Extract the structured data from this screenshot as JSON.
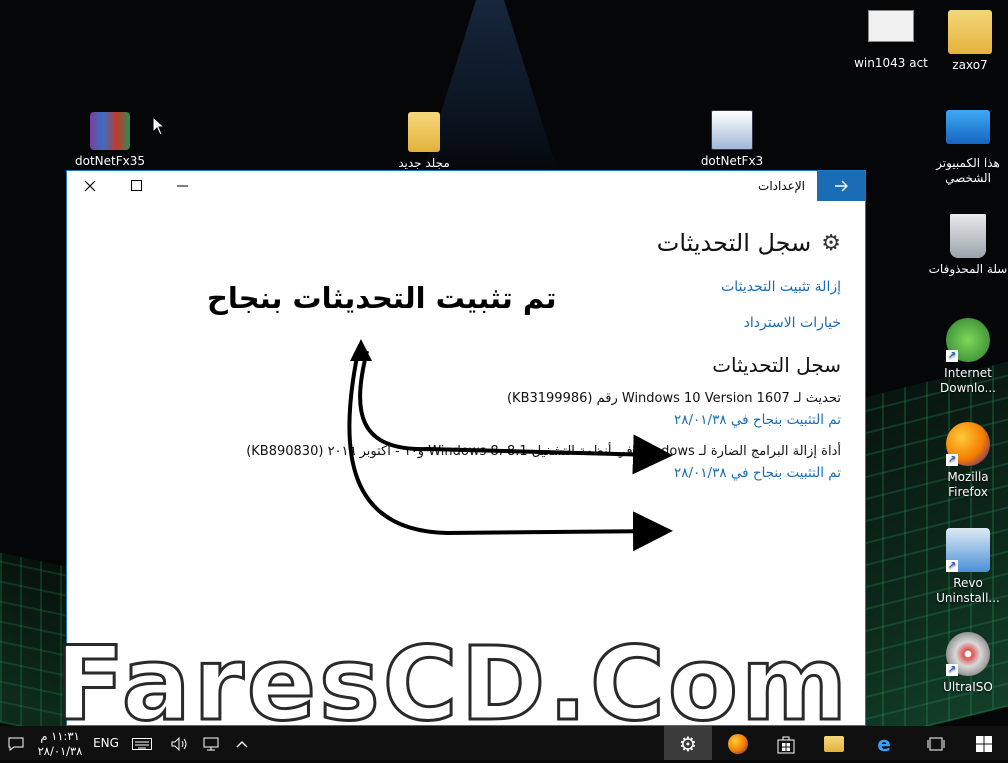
{
  "desktop": {
    "icons": [
      {
        "label": "zaxo7"
      },
      {
        "label": "win1043 act"
      },
      {
        "label": "هذا الكمبيوتر الشخصي"
      },
      {
        "label": "سلة المحذوفات"
      },
      {
        "label": "Internet Downlo..."
      },
      {
        "label": "Mozilla Firefox"
      },
      {
        "label": "Revo Uninstall..."
      },
      {
        "label": "UltraISO"
      },
      {
        "label": "dotNetFx35"
      },
      {
        "label": "مجلد جديد"
      },
      {
        "label": "dotNetFx3"
      }
    ]
  },
  "window": {
    "title": "الإعدادات",
    "back_icon": "back-arrow-icon",
    "page_title": "سجل التحديثات",
    "links": [
      "إزالة تثبيت التحديثات",
      "خيارات الاسترداد"
    ],
    "section_title": "سجل التحديثات",
    "updates": [
      {
        "name": "تحديث لـ Windows 10 Version 1607 رقم (KB3199986)",
        "status": "تم التثبيت بنجاح في ٢٨/٠١/٣٨"
      },
      {
        "name": "أداة إزالة البرامج الضارة لـ Windows في أنظمة التشغيل Windows 8، 8.1 و١٠ - أكتوبر ٢٠١٦ (KB890830)",
        "status": "تم التثبيت بنجاح في ٢٨/٠١/٣٨"
      }
    ]
  },
  "annotation": "تم تثبيت التحديثات بنجاح",
  "watermark": "FaresCD.Com",
  "taskbar": {
    "language": "ENG",
    "time": "١١:٣١ م",
    "date": "٢٨/٠١/٣٨",
    "apps": [
      "settings-icon",
      "firefox-icon",
      "store-icon",
      "file-explorer-icon",
      "edge-icon",
      "task-view-icon",
      "start-icon"
    ]
  },
  "colors": {
    "accent": "#1a6db5",
    "taskbar": "#101010"
  }
}
